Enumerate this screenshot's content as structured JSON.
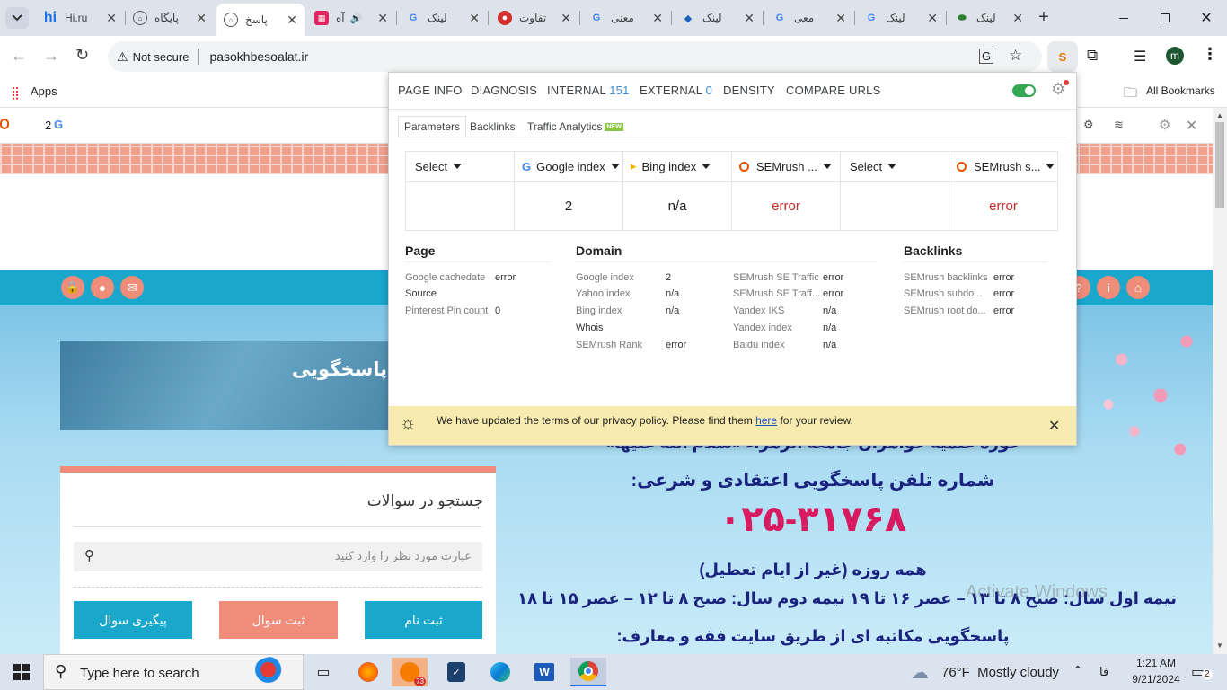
{
  "tabs": [
    {
      "title": "Hi.ru",
      "icon": "hi"
    },
    {
      "title": "پایگاه",
      "icon": "site"
    },
    {
      "title": "پاسخ",
      "icon": "site"
    },
    {
      "title": "آه",
      "icon": "app"
    },
    {
      "title": "لینک",
      "icon": "google"
    },
    {
      "title": "تفاوت",
      "icon": "red"
    },
    {
      "title": "معنی",
      "icon": "google"
    },
    {
      "title": "لینک",
      "icon": "link"
    },
    {
      "title": "معی",
      "icon": "google"
    },
    {
      "title": "لینک",
      "icon": "google"
    },
    {
      "title": "لینک",
      "icon": "green"
    }
  ],
  "toolbar": {
    "security_label": "Not secure",
    "url": "pasokhbesoalat.ir",
    "profile_initial": "m"
  },
  "bookmarks": {
    "apps_label": "Apps",
    "all_bookmarks_label": "All Bookmarks"
  },
  "page": {
    "ext_count": "2",
    "header_text": "پاسخگویی",
    "search_title": "جستجو در سوالات",
    "search_placeholder": "عبارت مورد نظر را وارد کنید",
    "buttons": {
      "track": "پیگیری سوال",
      "submit": "ثبت سوال",
      "register": "ثبت نام"
    },
    "banner_lines": [
      "حوزه علمیه خواهران جامعه الزهراء «سلام الله علیها»",
      "شماره تلفن پاسخگویی اعتقادی و شرعی:",
      "۰۲۵-۳۱۷۶۸",
      "همه روزه (غیر از ایام تعطیل)",
      "نیمه اول سال: صبح ۸ تا ۱۳ – عصر ۱۶ تا ۱۹    نیمه دوم سال: صبح ۸ تا ۱۲ – عصر ۱۵ تا ۱۸",
      "پاسخگویی مکاتبه ای از طریق سایت فقه و معارف:"
    ],
    "watermark": "Activate Windows"
  },
  "popup": {
    "nav": [
      {
        "label": "PAGE INFO",
        "count": ""
      },
      {
        "label": "DIAGNOSIS",
        "count": ""
      },
      {
        "label": "INTERNAL",
        "count": "151"
      },
      {
        "label": "EXTERNAL",
        "count": "0"
      },
      {
        "label": "DENSITY",
        "count": ""
      },
      {
        "label": "COMPARE URLS",
        "count": ""
      }
    ],
    "subtabs": [
      "Parameters",
      "Backlinks",
      "Traffic Analytics"
    ],
    "new_badge": "NEW",
    "columns": [
      {
        "label": "Select",
        "value": "",
        "icon": ""
      },
      {
        "label": "Google index",
        "value": "2",
        "icon": "google"
      },
      {
        "label": "Bing index",
        "value": "n/a",
        "icon": "bing"
      },
      {
        "label": "SEMrush ...",
        "value": "error",
        "icon": "semrush"
      },
      {
        "label": "Select",
        "value": "",
        "icon": ""
      },
      {
        "label": "SEMrush s...",
        "value": "error",
        "icon": "semrush"
      }
    ],
    "sections": {
      "page": {
        "title": "Page",
        "rows": [
          {
            "label": "Google cachedate",
            "value": "error"
          },
          {
            "label": "Source",
            "value": ""
          },
          {
            "label": "Pinterest Pin count",
            "value": "0"
          }
        ]
      },
      "domain": {
        "title": "Domain",
        "left": [
          {
            "label": "Google index",
            "value": "2"
          },
          {
            "label": "Yahoo index",
            "value": "n/a"
          },
          {
            "label": "Bing index",
            "value": "n/a"
          },
          {
            "label": "Whois",
            "value": ""
          },
          {
            "label": "SEMrush Rank",
            "value": "error"
          }
        ],
        "right": [
          {
            "label": "SEMrush SE Traffic",
            "value": "error"
          },
          {
            "label": "SEMrush SE Traff...",
            "value": "error"
          },
          {
            "label": "Yandex IKS",
            "value": "n/a"
          },
          {
            "label": "Yandex index",
            "value": "n/a"
          },
          {
            "label": "Baidu index",
            "value": "n/a"
          }
        ]
      },
      "backlinks": {
        "title": "Backlinks",
        "rows": [
          {
            "label": "SEMrush backlinks",
            "value": "error"
          },
          {
            "label": "SEMrush subdo...",
            "value": "error"
          },
          {
            "label": "SEMrush root do...",
            "value": "error"
          }
        ]
      }
    },
    "notice": {
      "before": "We have updated the terms of our privacy policy. Please find them ",
      "link": "here",
      "after": " for your review."
    }
  },
  "taskbar": {
    "search_placeholder": "Type here to search",
    "weather": "76°F  Mostly cloudy",
    "lang": "فا",
    "time": "1:21 AM",
    "date": "9/21/2024",
    "notifications": "2",
    "badge_count": "73"
  },
  "colors": {
    "teal": "#1aa7cc",
    "salmon": "#ef8c7a",
    "toggle_green": "#34a853"
  }
}
